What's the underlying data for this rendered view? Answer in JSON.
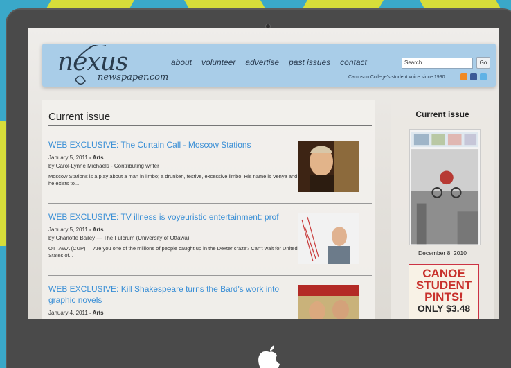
{
  "site": {
    "logo_text": "nexus",
    "logo_sub": "newspaper.com",
    "nav": [
      "about",
      "volunteer",
      "advertise",
      "past issues",
      "contact"
    ],
    "search_value": "Search",
    "go_label": "Go",
    "tagline": "Camosun College's student voice since 1990"
  },
  "main": {
    "title": "Current issue",
    "articles": [
      {
        "title": "WEB EXCLUSIVE: The Curtain Call - Moscow Stations",
        "date": "January 5, 2011",
        "category": "Arts",
        "byline": "by Carol-Lynne Michaels - Contributing writer",
        "excerpt": "Moscow Stations is a play about a man in limbo; a drunken, festive, excessive limbo. His name is Venya and he exists to..."
      },
      {
        "title": "WEB EXCLUSIVE: TV illness is voyeuristic entertainment: prof",
        "date": "January 5, 2011",
        "category": "Arts",
        "byline": "by Charlotte Bailey — The Fulcrum (University of Ottawa)",
        "excerpt": "OTTAWA (CUP) — Are you one of the millions of people caught up in the Dexter craze? Can't wait for United States of..."
      },
      {
        "title": "WEB EXCLUSIVE: Kill Shakespeare turns the Bard's work into graphic novels",
        "date": "January 4, 2011",
        "category": "Arts"
      }
    ]
  },
  "sidebar": {
    "title": "Current issue",
    "cover_date": "December 8, 2010",
    "ad_lines": [
      "CANOE",
      "STUDENT",
      "PINTS!",
      "ONLY $3.48"
    ]
  },
  "colors": {
    "background": "#3aa8c9",
    "header": "#a9cde8",
    "link": "#3a8fd6",
    "ad_red": "#c8312c"
  }
}
